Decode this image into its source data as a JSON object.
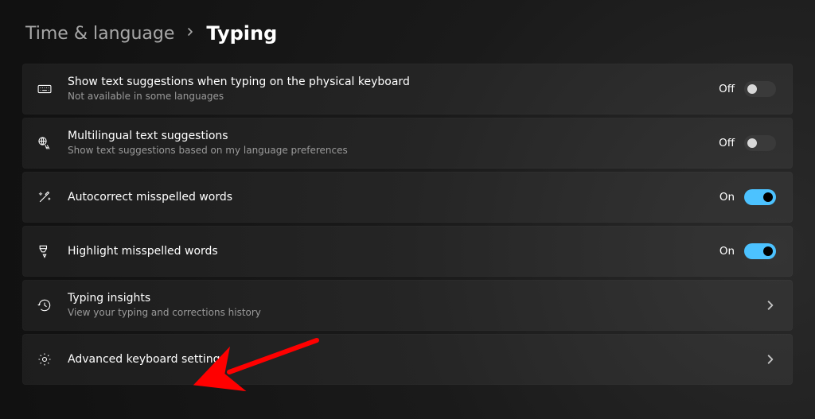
{
  "breadcrumb": {
    "parent": "Time & language",
    "current": "Typing"
  },
  "toggle_on_label": "On",
  "toggle_off_label": "Off",
  "items": {
    "text_suggestions": {
      "title": "Show text suggestions when typing on the physical keyboard",
      "sub": "Not available in some languages",
      "state": "off"
    },
    "multilingual": {
      "title": "Multilingual text suggestions",
      "sub": "Show text suggestions based on my language preferences",
      "state": "off"
    },
    "autocorrect": {
      "title": "Autocorrect misspelled words",
      "state": "on"
    },
    "highlight": {
      "title": "Highlight misspelled words",
      "state": "on"
    },
    "insights": {
      "title": "Typing insights",
      "sub": "View your typing and corrections history"
    },
    "advanced": {
      "title": "Advanced keyboard settings"
    }
  },
  "annotation": {
    "target": "advanced"
  }
}
